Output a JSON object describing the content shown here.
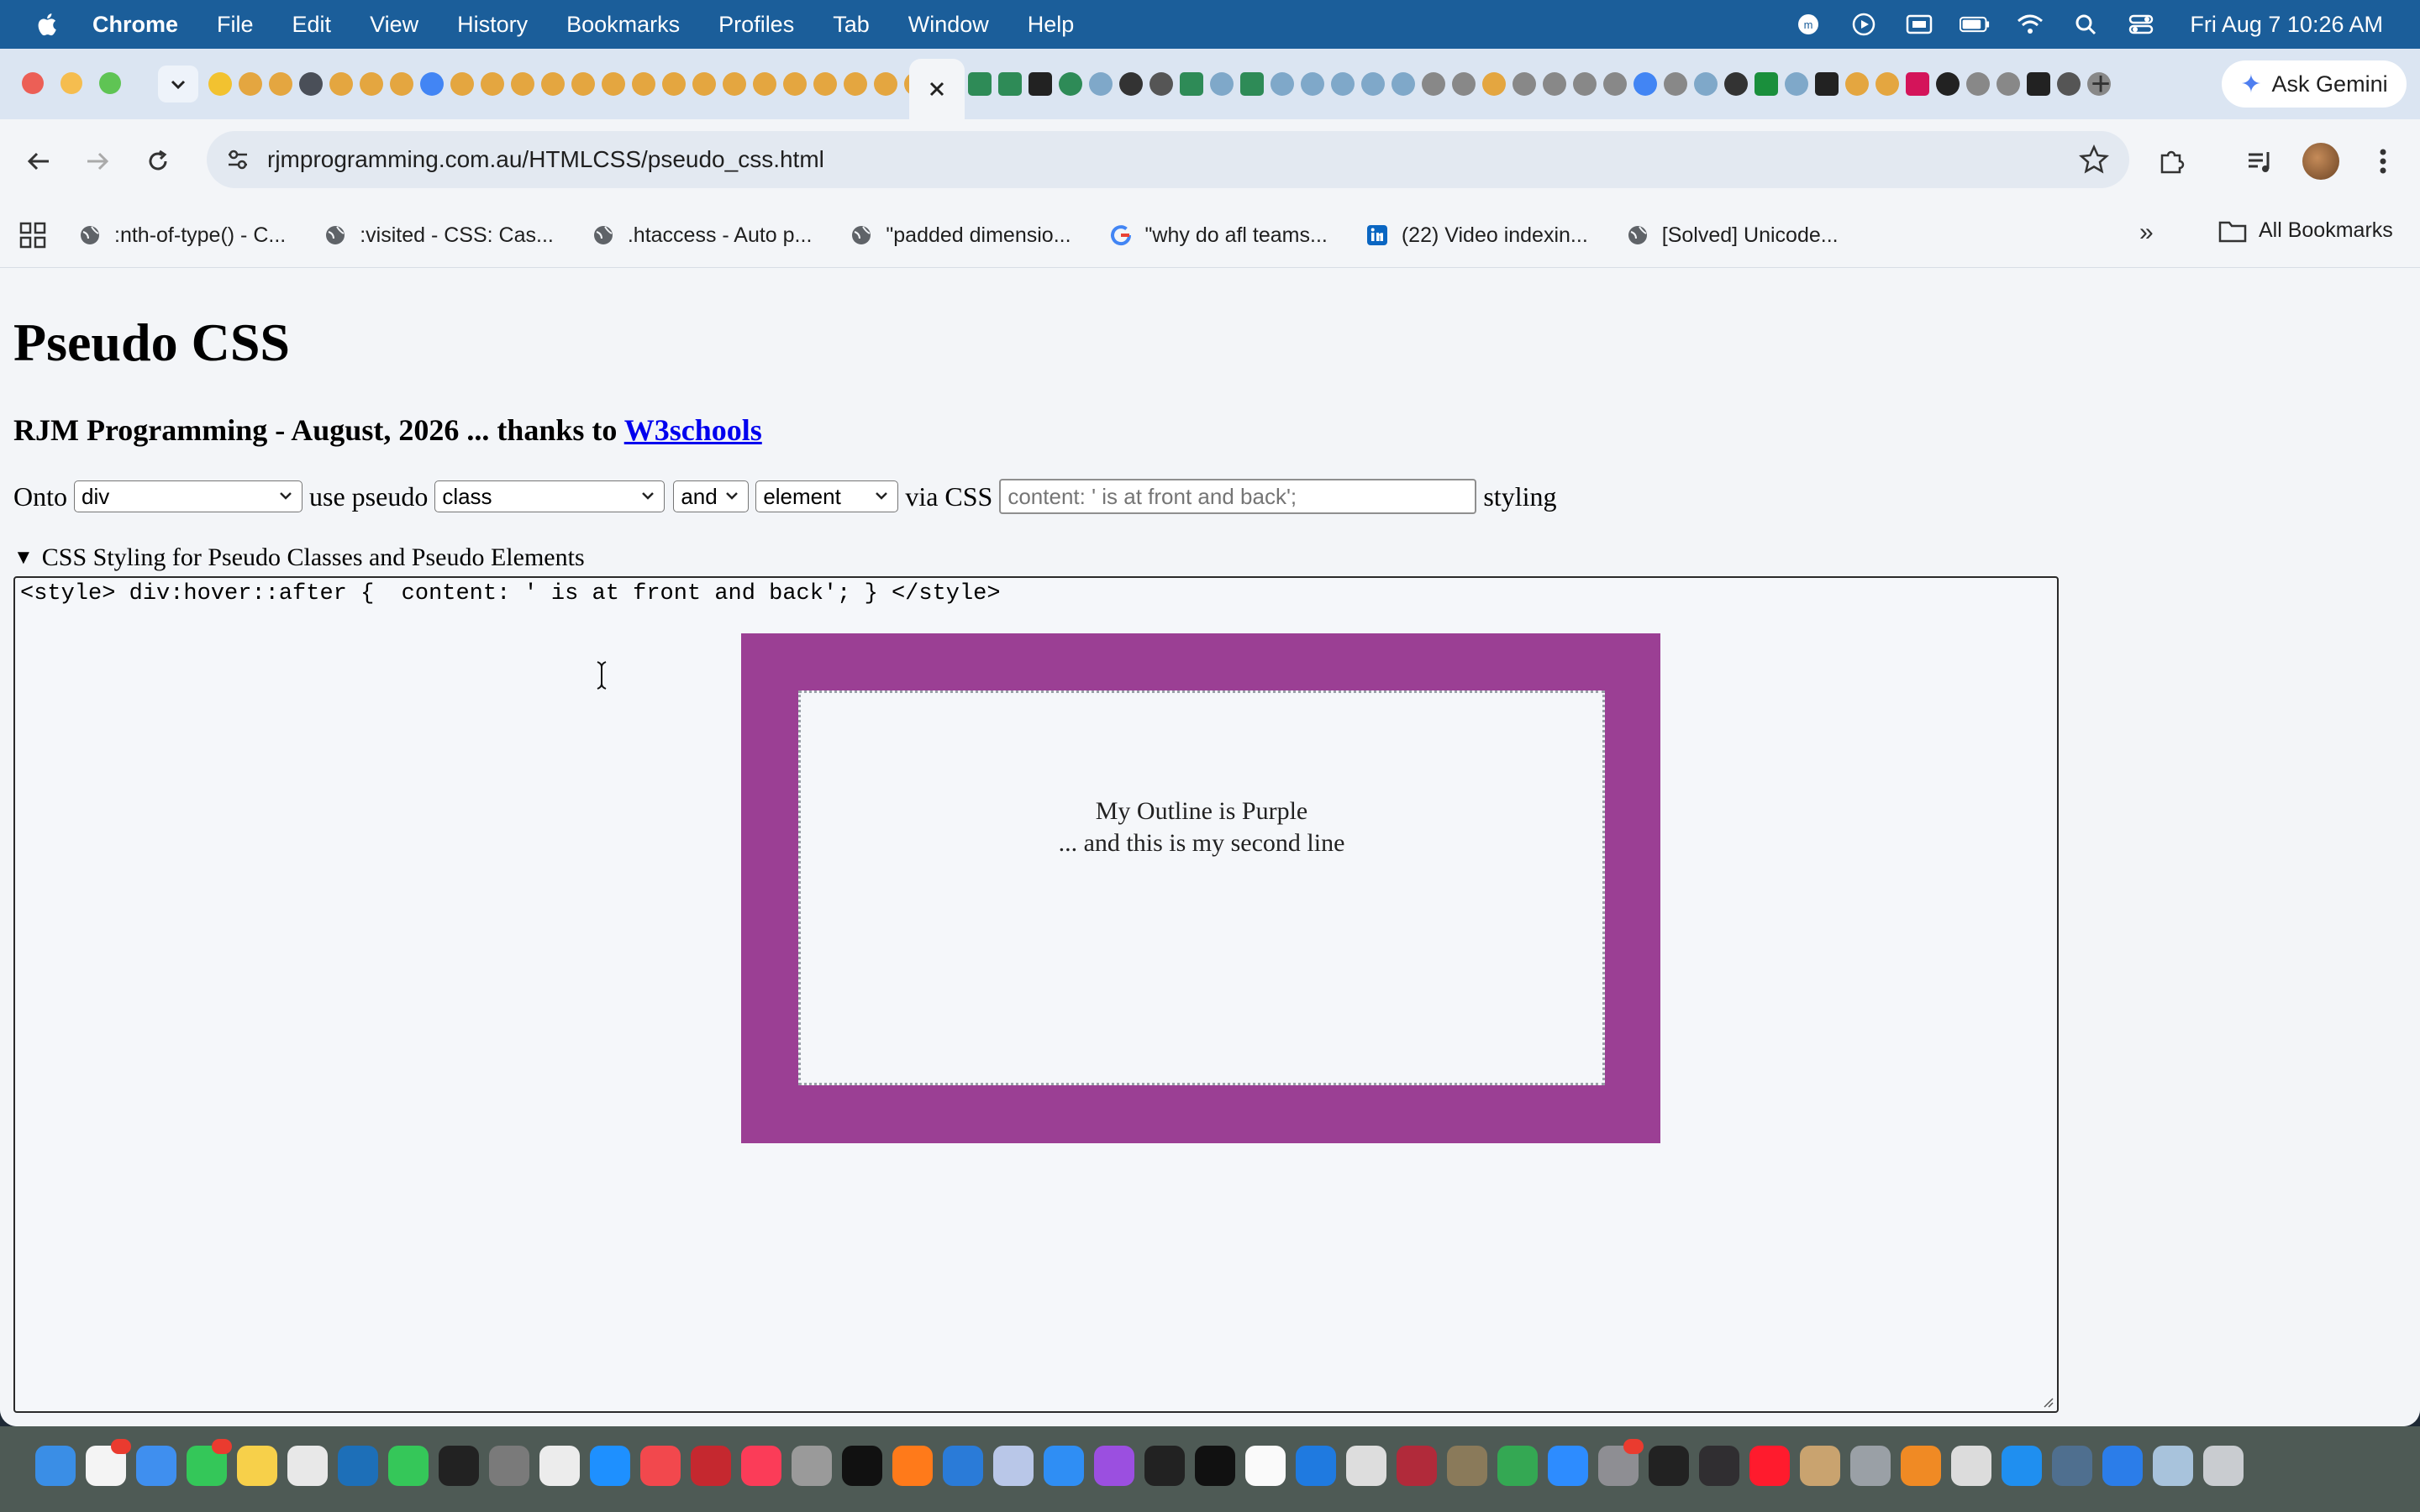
{
  "menubar": {
    "app_name": "Chrome",
    "items": [
      "File",
      "Edit",
      "View",
      "History",
      "Bookmarks",
      "Profiles",
      "Tab",
      "Window",
      "Help"
    ],
    "clock": "Fri Aug 7  10:26 AM"
  },
  "browser": {
    "gemini_label": "Ask Gemini",
    "url": "rjmprogramming.com.au/HTMLCSS/pseudo_css.html",
    "bookmarks": [
      ":nth-of-type() - C...",
      ":visited - CSS: Cas...",
      ".htaccess - Auto p...",
      "\"padded dimensio...",
      "\"why do afl teams...",
      "(22) Video indexin...",
      "[Solved] Unicode..."
    ],
    "all_bookmarks_label": "All Bookmarks"
  },
  "page": {
    "title": "Pseudo CSS",
    "subtitle_prefix": "RJM Programming - August, 2026 ... thanks to ",
    "subtitle_link": "W3schools",
    "controls": {
      "onto_label": "Onto",
      "onto_value": "div",
      "use_pseudo_label": "use pseudo",
      "pseudo_value": "class",
      "and_value": "and",
      "element_value": "element",
      "via_css_label": "via CSS",
      "css_placeholder": "content: ' is at front and back';",
      "styling_label": "styling"
    },
    "details_summary": "CSS Styling for Pseudo Classes and Pseudo Elements",
    "style_code": "<style> div:hover::after {  content: ' is at front and back'; } </style>",
    "demo_line1": "My Outline is Purple",
    "demo_line2": "... and this is my second line"
  },
  "colors": {
    "menubar_bg": "#1b5e9a",
    "demo_purple": "#9b3f94",
    "link_blue": "#0000ee"
  }
}
